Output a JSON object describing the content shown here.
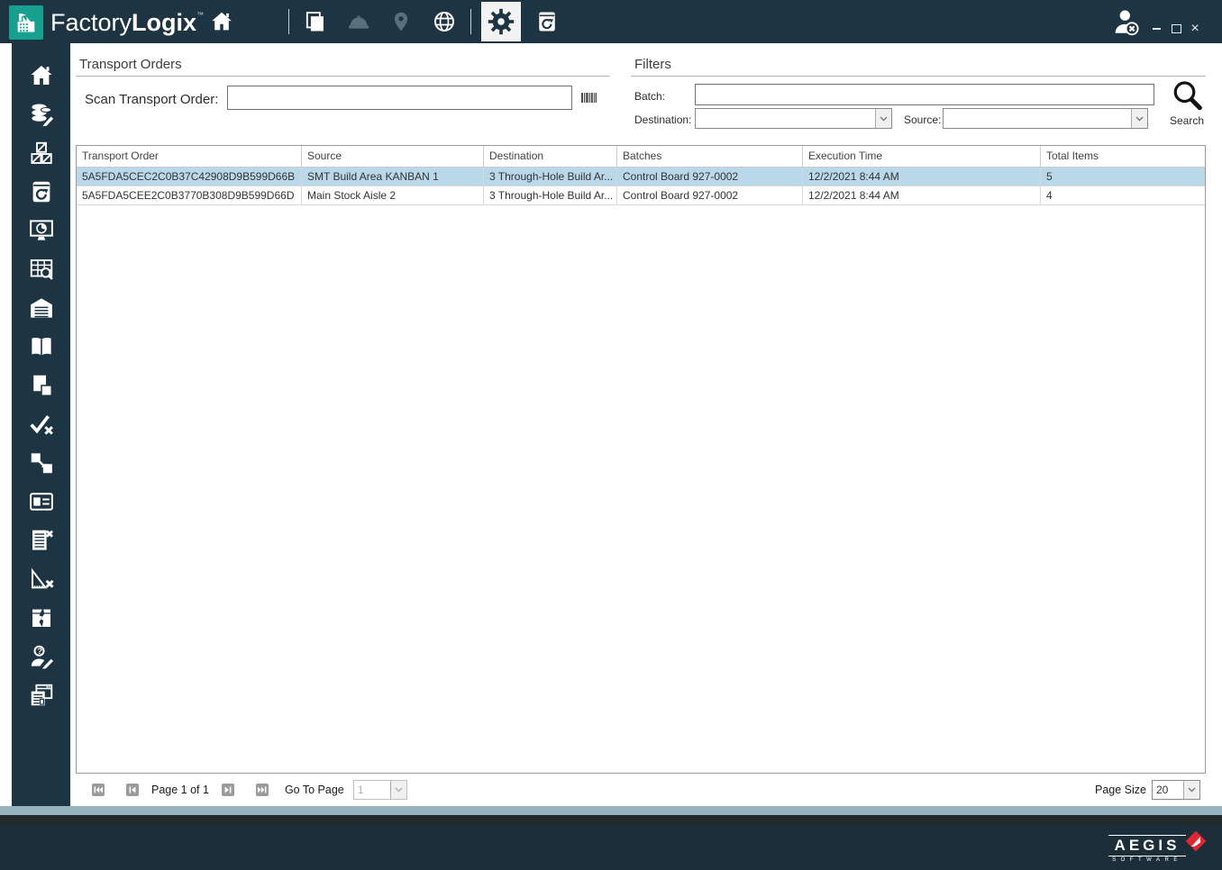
{
  "titlebar": {
    "brand": {
      "part1": "Factory",
      "part2": "Logix",
      "tm": "™"
    },
    "icons": [
      "home",
      "copy-pages",
      "hardhat",
      "location-pin",
      "globe",
      "settings-gear",
      "device-refresh",
      "user-logout"
    ]
  },
  "sidebar": {
    "icons": [
      "home",
      "database-edit",
      "material-boxes",
      "device-refresh",
      "dashboard-monitor",
      "table-search",
      "warehouse",
      "documentation-book",
      "documents-copy",
      "verify-check",
      "material-transfer",
      "id-card",
      "checklist-remove",
      "measure-remove",
      "damaged-package",
      "operator-question",
      "production-windows"
    ]
  },
  "transport_orders": {
    "section_title": "Transport Orders",
    "scan_label": "Scan Transport Order:",
    "scan_value": "",
    "scan_placeholder": ""
  },
  "filters": {
    "section_title": "Filters",
    "batch_label": "Batch:",
    "batch_value": "",
    "destination_label": "Destination:",
    "destination_value": "",
    "source_label": "Source:",
    "source_value": "",
    "search_label": "Search"
  },
  "table": {
    "columns": [
      "Transport Order",
      "Source",
      "Destination",
      "Batches",
      "Execution Time",
      "Total Items"
    ],
    "rows": [
      {
        "transport_order": "5A5FDA5CEC2C0B37C42908D9B599D66B",
        "source": "SMT Build Area KANBAN 1",
        "destination": "3 Through-Hole Build Ar...",
        "batches": "Control Board 927-0002",
        "execution_time": "12/2/2021 8:44 AM",
        "total_items": "5",
        "selected": true
      },
      {
        "transport_order": "5A5FDA5CEE2C0B3770B308D9B599D66D",
        "source": "Main Stock Aisle 2",
        "destination": "3 Through-Hole Build Ar...",
        "batches": "Control Board 927-0002",
        "execution_time": "12/2/2021 8:44 AM",
        "total_items": "4",
        "selected": false
      }
    ]
  },
  "pagination": {
    "page_label": "Page 1 of 1",
    "goto_label": "Go To Page",
    "goto_value": "1",
    "page_size_label": "Page Size",
    "page_size_value": "20"
  },
  "footer": {
    "brand": "AEGIS",
    "brand_sub": "SOFTWARE"
  },
  "colors": {
    "topbar": "#1d3442",
    "accent_teal": "#17a08d",
    "selected_row": "#b9d8ea",
    "footer_strip": "#96b3c0",
    "footer_dark_strip": "#232a2c",
    "footer_navy": "#1b2e3a",
    "logo_red": "#e4252f"
  }
}
